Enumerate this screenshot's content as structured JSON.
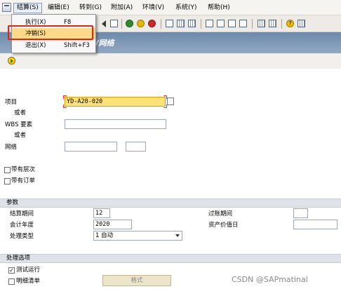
{
  "menu_bar": {
    "items": [
      "结算(S)",
      "编辑(E)",
      "转到(G)",
      "附加(A)",
      "环境(V)",
      "系统(Y)",
      "帮助(H)"
    ]
  },
  "title": "WBS要素/网络",
  "dropdown": {
    "items": [
      {
        "label": "执行(X)",
        "shortcut": "F8"
      },
      {
        "label": "冲销(S)",
        "shortcut": ""
      },
      {
        "label": "退出(X)",
        "shortcut": "Shift+F3"
      }
    ]
  },
  "selection": {
    "project_label": "项目",
    "project_value": "YD-A20-020",
    "or_1": "或者",
    "wbs_label": "WBS 要素",
    "or_2": "或者",
    "network_label": "网络",
    "with_hierarchy_label": "带有层次",
    "with_orders_label": "带有订单"
  },
  "parameters": {
    "heading": "参数",
    "settlement_period_label": "结算期间",
    "settlement_period_value": "12",
    "fiscal_year_label": "会计年度",
    "fiscal_year_value": "2020",
    "processing_type_label": "处理类型",
    "processing_type_value": "1 自动",
    "posting_period_label": "过账期间",
    "asset_value_date_label": "资产价值日"
  },
  "processing_options": {
    "heading": "处理选项",
    "test_run_label": "测试运行",
    "test_run_checked": true,
    "detail_list_label": "明细清单",
    "detail_list_checked": false,
    "format_button_label": "格式"
  },
  "watermark": "CSDN @SAPmatinal"
}
